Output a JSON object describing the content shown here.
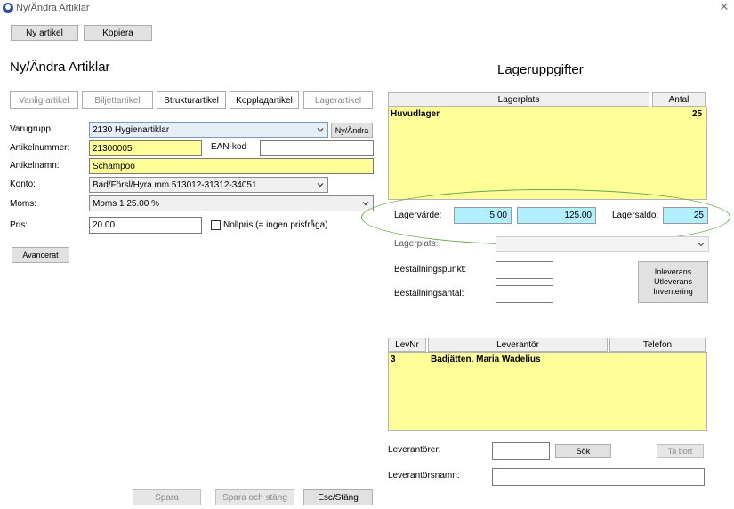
{
  "window": {
    "title": "Ny/Ändra Artiklar",
    "close_glyph": "✕"
  },
  "toolbar": {
    "new_label": "Ny artikel",
    "copy_label": "Kopiera"
  },
  "left": {
    "heading": "Ny/Ändra Artiklar",
    "tabs": [
      {
        "label": "Vanlig artikel",
        "enabled": false
      },
      {
        "label": "Biljettartikel",
        "enabled": false
      },
      {
        "label": "Strukturartikel",
        "enabled": true
      },
      {
        "label": "Kopplадartikel",
        "enabled": true
      },
      {
        "label": "Lagerartikel",
        "enabled": false
      }
    ],
    "varugrupp_label": "Varugrupp:",
    "varugrupp_value": "2130 Hygienartiklar",
    "ny_andra_label": "Ny/Ändra",
    "artikelnummer_label": "Artikelnummer:",
    "artikelnummer_value": "21300005",
    "ean_label": "EAN-kod",
    "ean_value": "",
    "artikelnamn_label": "Artikelnamn:",
    "artikelnamn_value": "Schampoo",
    "konto_label": "Konto:",
    "konto_value": "Bad/Försl/Hyra mm 513012-31312-34051",
    "moms_label": "Moms:",
    "moms_value": "Moms 1 25.00 %",
    "pris_label": "Pris:",
    "pris_value": "20.00",
    "nollpris_label": "Nollpris (= ingen prisfråga)",
    "avancerat_label": "Avancerat"
  },
  "right": {
    "heading": "Lageruppgifter",
    "stock_grid": {
      "headers": [
        "Lagerplats",
        "Antal"
      ],
      "rows": [
        {
          "lagerplats": "Huvudlager",
          "antal": "25"
        }
      ]
    },
    "lagervarde_label": "Lagervärde:",
    "lagervarde_unit": "5.00",
    "lagervarde_total": "125.00",
    "lagersaldo_label": "Lagersaldo:",
    "lagersaldo_value": "25",
    "lagerplats_label": "Lagerplats:",
    "bestallningspunkt_label": "Beställningspunkt:",
    "bestallningsantal_label": "Beställningsantal:",
    "inleverans_label": "Inleverans",
    "utleverans_label": "Utleverans",
    "inventering_label": "Inventering",
    "supplier_grid": {
      "headers": [
        "LevNr",
        "Leverantör",
        "Telefon"
      ],
      "rows": [
        {
          "levnr": "3",
          "leverantor": "Badjätten, Maria Wadelius",
          "telefon": ""
        }
      ]
    },
    "leverantorer_label": "Leverantörer:",
    "sok_label": "Sök",
    "ta_bort_label": "Ta bort",
    "leverantorsnamn_label": "Leverantörsnamn:"
  },
  "footer": {
    "spara_label": "Spara",
    "spara_stang_label": "Spara och stäng",
    "esc_label": "Esc/Stäng"
  },
  "colors": {
    "highlight_yellow": "#ffff99",
    "value_cyan": "#b3f0ff",
    "annotation_green": "#6aa84f"
  }
}
